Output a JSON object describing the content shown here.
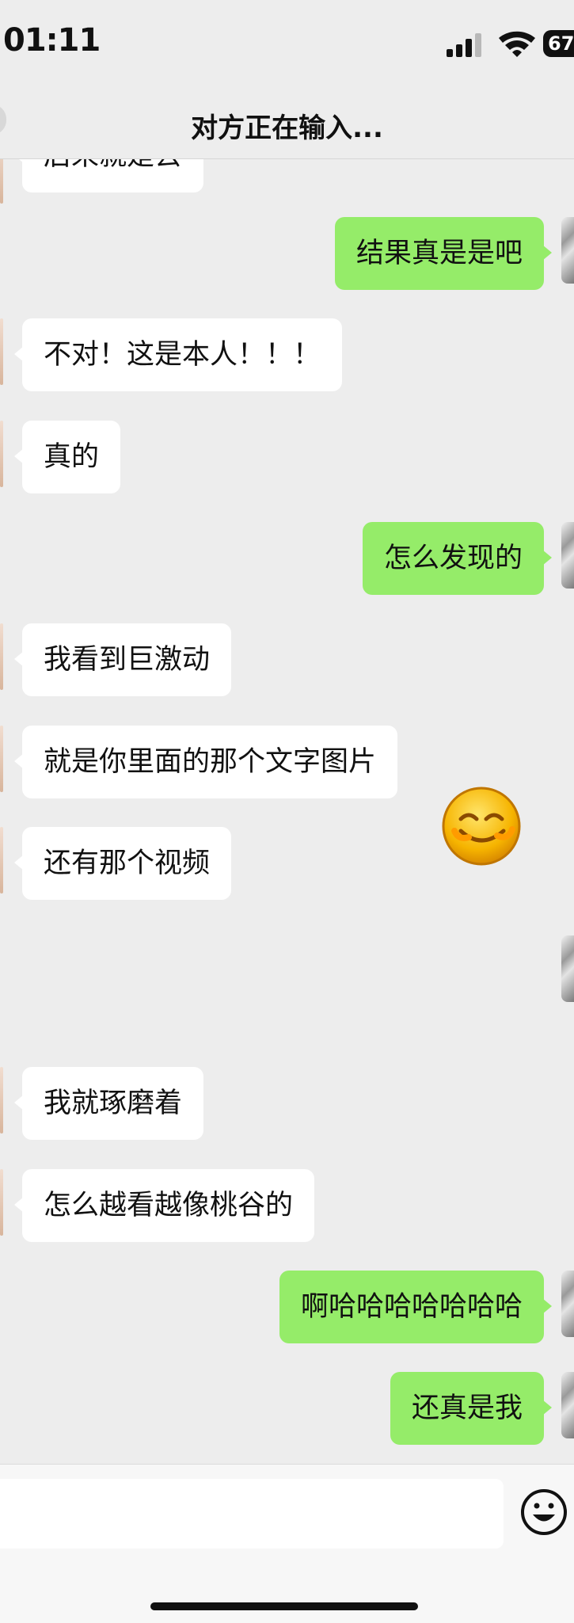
{
  "status_bar": {
    "time": "01:11",
    "battery": "67"
  },
  "header": {
    "title": "对方正在输入..."
  },
  "messages": [
    {
      "from": "them",
      "text": "后来就是去"
    },
    {
      "from": "me",
      "text": "结果真是是吧"
    },
    {
      "from": "them",
      "text": "不对！这是本人！！！"
    },
    {
      "from": "them",
      "text": "真的"
    },
    {
      "from": "me",
      "text": "怎么发现的"
    },
    {
      "from": "them",
      "text": "我看到巨激动"
    },
    {
      "from": "them",
      "text": "就是你里面的那个文字图片"
    },
    {
      "from": "them",
      "text": "还有那个视频"
    },
    {
      "from": "me",
      "type": "emoji",
      "icon": "grinning-face-emoji-icon"
    },
    {
      "from": "them",
      "text": "我就琢磨着"
    },
    {
      "from": "them",
      "text": "怎么越看越像桃谷的"
    },
    {
      "from": "me",
      "text": "啊哈哈哈哈哈哈哈"
    },
    {
      "from": "me",
      "text": "还真是我"
    }
  ],
  "input": {
    "value": "",
    "placeholder": ""
  },
  "icons": {
    "signal": "signal-icon",
    "wifi": "wifi-icon",
    "emoji_button": "smiley-face-icon"
  },
  "colors": {
    "background": "#ededed",
    "incoming_bubble": "#ffffff",
    "outgoing_bubble": "#95ec69",
    "text": "#111111"
  }
}
